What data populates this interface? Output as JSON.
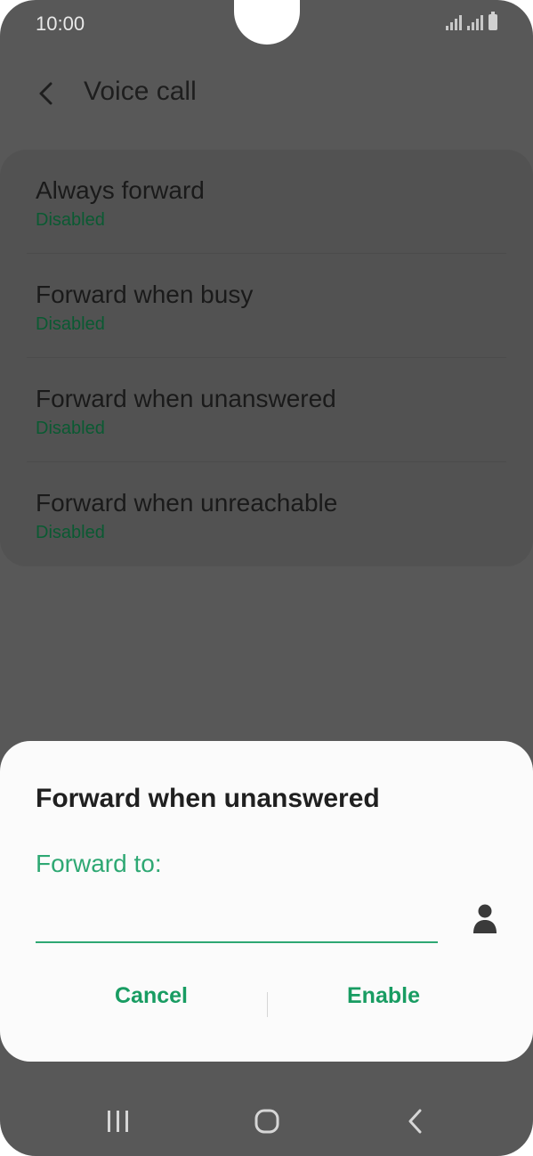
{
  "status_bar": {
    "time": "10:00",
    "icons": [
      "signal-icon",
      "signal-icon",
      "battery-icon"
    ]
  },
  "header": {
    "back_icon": "chevron-left-icon",
    "title": "Voice call"
  },
  "forward_options": [
    {
      "title": "Always forward",
      "status": "Disabled"
    },
    {
      "title": "Forward when busy",
      "status": "Disabled"
    },
    {
      "title": "Forward when unanswered",
      "status": "Disabled"
    },
    {
      "title": "Forward when unreachable",
      "status": "Disabled"
    }
  ],
  "dialog": {
    "title": "Forward when unanswered",
    "field_label": "Forward to:",
    "field_value": "",
    "contact_icon": "person-icon",
    "cancel_label": "Cancel",
    "enable_label": "Enable"
  },
  "nav_bar": {
    "recent_icon": "recent-apps-icon",
    "home_icon": "home-icon",
    "back_icon": "back-icon"
  },
  "colors": {
    "accent": "#2ea873",
    "status_text": "#0a5a32",
    "scrim": "#585858",
    "dialog_bg": "#fbfbfb"
  }
}
